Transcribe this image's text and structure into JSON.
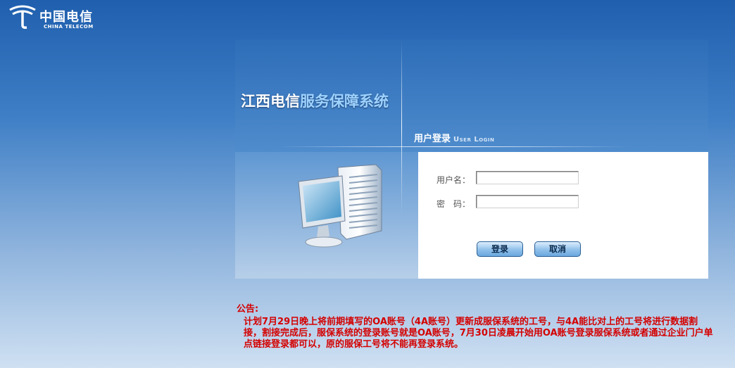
{
  "brand": {
    "name_cn": "中国电信",
    "name_en": "CHINA TELECOM"
  },
  "header": {
    "title_part1": "江西电信",
    "title_part2": "服务保障系统"
  },
  "login": {
    "title_cn": "用户登录",
    "title_en": "User Login",
    "username_label": "用户名：",
    "password_label": "密　码：",
    "username_value": "",
    "password_value": "",
    "login_button": "登录",
    "cancel_button": "取消"
  },
  "notice": {
    "title": "公告:",
    "body": "计划7月29日晚上将前期填写的OA账号（4A账号）更新成服保系统的工号，与4A能比对上的工号将进行数据割接，割接完成后，服保系统的登录账号就是OA账号，7月30日凌晨开始用OA账号登录服保系统或者通过企业门户单点链接登录都可以，原的服保工号将不能再登录系统。"
  },
  "colors": {
    "notice": "#d40000",
    "title_accent": "#9ed3ff"
  },
  "icons": [
    "china-telecom-logo",
    "server-computer-illustration"
  ]
}
